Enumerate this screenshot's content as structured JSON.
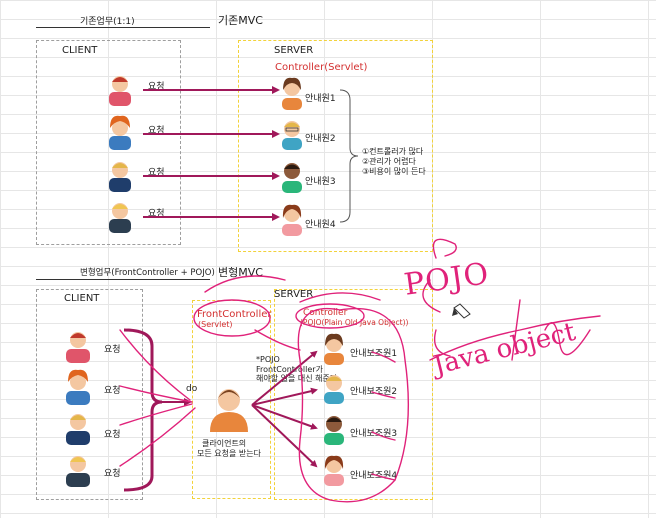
{
  "top": {
    "task_label": "기존업무(1:1)",
    "title": "기존MVC",
    "client_label": "CLIENT",
    "server_label": "SERVER",
    "controller_label": "Controller(Servlet)",
    "request_label": "요청",
    "agents": [
      "안내원1",
      "안내원2",
      "안내원3",
      "안내원4"
    ],
    "problems": [
      "①컨트롤러가 많다",
      "②관리가 어렵다",
      "③비용이 많이 든다"
    ]
  },
  "bottom": {
    "task_label": "변형업무(FrontController + POJO)",
    "title": "변형MVC",
    "client_label": "CLIENT",
    "server_label": "SERVER",
    "front_controller_label": "FrontController",
    "front_controller_sub": "(Servlet)",
    "controller_label": "Controller",
    "controller_sub": "(POJO(Plain Old Java Object))",
    "request_label": "요청",
    "do_label": "do",
    "note_lines": [
      "*POJO",
      "FrontController가",
      "해야할 일을 대신 해준다"
    ],
    "front_desc_lines": [
      "클라이언트의",
      "모든 요청을 받는다"
    ],
    "assistants": [
      "안내보조원1",
      "안내보조원2",
      "안내보조원3",
      "안내보조원4"
    ]
  },
  "handwriting": {
    "word1": "POJO",
    "word2": "Java object"
  },
  "colors": {
    "arrow": "#a0185a",
    "ink": "#e0227a",
    "red_text": "#d32f2f",
    "yellow_dash": "#f2d23a",
    "gray_dash": "#9e9e9e"
  }
}
